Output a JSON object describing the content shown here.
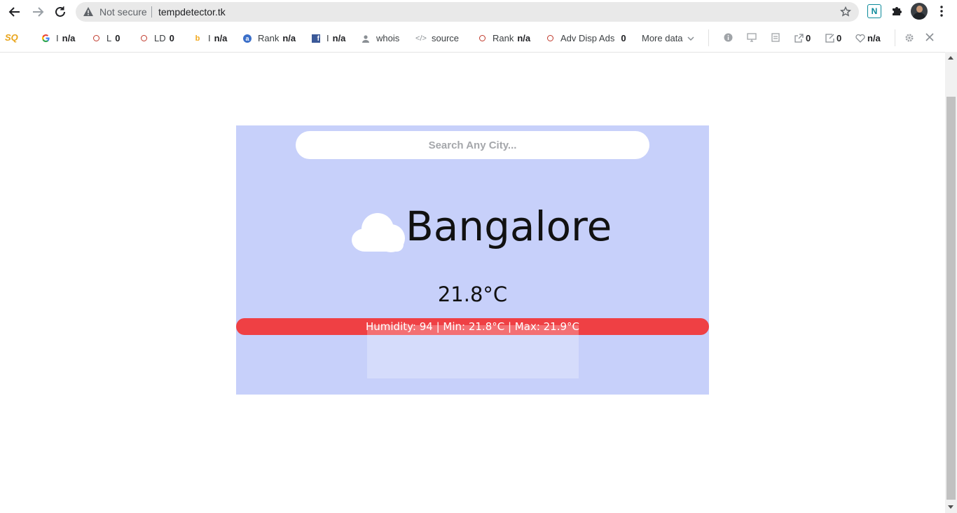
{
  "browser": {
    "security_label": "Not secure",
    "url": "tempdetector.tk",
    "extension_label": "N"
  },
  "seoquake": {
    "logo": "SQ",
    "items": [
      {
        "label": "I",
        "value": "n/a",
        "icon": "google-icon"
      },
      {
        "label": "L",
        "value": "0",
        "icon": "circle-icon"
      },
      {
        "label": "LD",
        "value": "0",
        "icon": "circle-icon"
      },
      {
        "label": "I",
        "value": "n/a",
        "icon": "bing-icon"
      },
      {
        "label": "Rank",
        "value": "n/a",
        "icon": "alexa-icon"
      },
      {
        "label": "I",
        "value": "n/a",
        "icon": "facebook-icon"
      },
      {
        "label": "whois",
        "value": "",
        "icon": "person-icon"
      },
      {
        "label": "source",
        "value": "",
        "icon": "code-icon"
      },
      {
        "label": "Rank",
        "value": "n/a",
        "icon": "circle-icon"
      },
      {
        "label": "Adv Disp Ads",
        "value": "0",
        "icon": "circle-icon"
      }
    ],
    "more_data": "More data",
    "mini": [
      {
        "icon": "info-icon",
        "value": ""
      },
      {
        "icon": "display-icon",
        "value": ""
      },
      {
        "icon": "page-icon",
        "value": ""
      },
      {
        "icon": "external-link-icon",
        "value": "0"
      },
      {
        "icon": "internal-link-icon",
        "value": "0"
      },
      {
        "icon": "heart-icon",
        "value": "n/a"
      }
    ]
  },
  "weather": {
    "search_placeholder": "Search Any City...",
    "city": "Bangalore",
    "temperature": "21.8°C",
    "details": "Humidity: 94 | Min: 21.8°C | Max: 21.9°C",
    "condition_icon": "cloud-icon"
  },
  "colors": {
    "card_bg": "#c7d0fa",
    "info_bar": "#ef4044"
  }
}
